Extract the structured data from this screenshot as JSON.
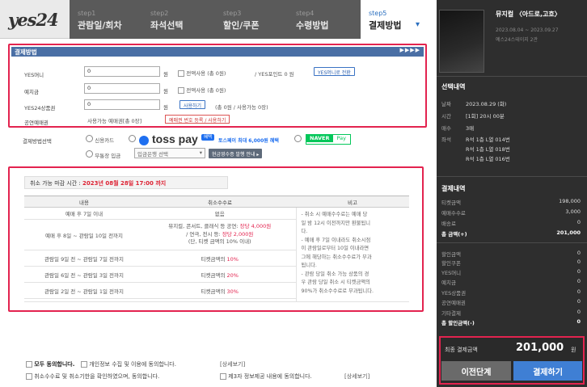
{
  "header": {
    "logo": "yes24",
    "steps": [
      {
        "num": "step1",
        "label": "관람일/회차"
      },
      {
        "num": "step2",
        "label": "좌석선택"
      },
      {
        "num": "step3",
        "label": "할인/쿠폰"
      },
      {
        "num": "step4",
        "label": "수령방법"
      },
      {
        "num": "step5",
        "label": "결제방법"
      }
    ]
  },
  "payment": {
    "section_title": "결제방법",
    "yes_money_label": "YES머니",
    "yes_money_value": "0",
    "yes_money_all": "전액사용 (총 0원)",
    "yes_point": "/ YES포인트 0 원",
    "yes_convert_btn": "YES머니로 전환",
    "deposit_label": "예치금",
    "deposit_value": "0",
    "deposit_all": "전액사용 (총 0원)",
    "gift_label": "YES24상품권",
    "gift_value": "0",
    "gift_use_btn": "사용하기",
    "gift_info": "(총 0원 / 사용가능 0장)",
    "show_ticket_label": "공연예매권",
    "show_ticket_info": "사용가능 예매권[총 0장]",
    "show_ticket_btn": "예매권 번호 등록 / 사용하기",
    "won": "원"
  },
  "method": {
    "label": "결제방법선택",
    "credit_card": "신용카드",
    "toss_logo": "toss pay",
    "toss_badge": "혜택",
    "toss_promo": "토스페이 최대 6,000원 혜택",
    "naver": "NAVER",
    "naver_pay": "Pay",
    "bank": "무통장 입금",
    "bank_select": "입금은행 선택",
    "receipt_btn": "현금영수증 발행 안내 ▸"
  },
  "cancel": {
    "deadline_label": "취소 가능 마감 시간 :",
    "deadline_value": "2023년 08월 28일 17:00 까지",
    "col_content": "내용",
    "col_fee": "취소수수료",
    "col_note": "비고",
    "rows": [
      {
        "content": "예매 후 7일 이내",
        "fee": "없음"
      },
      {
        "content": "예매 후 8일 ~ 관람일 10일 전까지",
        "fee_line1": "뮤지컬, 콘서트, 클래식 등 공연: ",
        "fee_red1": "장당 4,000원",
        "fee_line2": "/ 연극, 전시 등: ",
        "fee_red2": "장당 2,000원",
        "fee_line3": "(단, 티켓 금액의 10% 이내)"
      },
      {
        "content": "관람일 9일 전 ~ 관람일 7일 전까지",
        "fee": "티켓금액의 ",
        "fee_red": "10%"
      },
      {
        "content": "관람일 6일 전 ~ 관람일 3일 전까지",
        "fee": "티켓금액의 ",
        "fee_red": "20%"
      },
      {
        "content": "관람일 2일 전 ~ 관람일 1일 전까지",
        "fee": "티켓금액의 ",
        "fee_red": "30%"
      }
    ],
    "note": [
      "- 취소 시 예매수수료는 예매 당",
      "일 밤 12시 이전까지만 환불됩니",
      "다.",
      "- 예매 후 7일 이내라도 취소시점",
      "이 관람일로부터 10일 이내라면",
      "그에 해당하는 취소수수료가 부과",
      "됩니다.",
      "- 관람 당일 취소 가능 상품의 경",
      "우 관람 당일 취소 시 티켓금액의",
      "90%가 취소수수료로 부과됩니다."
    ]
  },
  "agree": {
    "all": "모두 동의합니다.",
    "privacy": "개인정보 수집 및 이용에 동의합니다.",
    "view": "[상세보기]",
    "cancel_terms": "취소수수료 및 취소기한을 확인하였으며, 동의합니다.",
    "third": "제3자 정보제공 내용에 동의합니다."
  },
  "sidebar": {
    "show_title": "뮤지컬 〈아드로,고흐〉",
    "show_period": "2023.08.04 ~ 2023.09.27",
    "show_venue": "예스24스테이지 2관",
    "booking_h": "선택내역",
    "date_k": "날짜",
    "date_v": "2023.08.29 (화)",
    "time_k": "시간",
    "time_v": "[1회] 20시 00분",
    "count_k": "매수",
    "count_v": "3매",
    "seat_k": "좌석",
    "seats": [
      "R석 1층 L열 014번",
      "R석 1층 L열 018번",
      "R석 1층 L열 016번"
    ],
    "pay_h": "결제내역",
    "ticket_k": "티켓금액",
    "ticket_v": "198,000",
    "fee_k": "예매수수료",
    "fee_v": "3,000",
    "delivery_k": "배송료",
    "delivery_v": "0",
    "total_k": "총 금액(+)",
    "total_v": "201,000",
    "discount": [
      {
        "k": "할인금액",
        "v": "0"
      },
      {
        "k": "할인쿠폰",
        "v": "0"
      },
      {
        "k": "YES머니",
        "v": "0"
      },
      {
        "k": "예치금",
        "v": "0"
      },
      {
        "k": "YES상품권",
        "v": "0"
      },
      {
        "k": "공연예매권",
        "v": "0"
      },
      {
        "k": "기타결제",
        "v": "0"
      },
      {
        "k": "총 할인금액(-)",
        "v": "0"
      }
    ],
    "final_k": "최종 결제금액",
    "final_v": "201,000",
    "final_unit": "원",
    "prev_btn": "이전단계",
    "pay_btn": "결제하기"
  }
}
